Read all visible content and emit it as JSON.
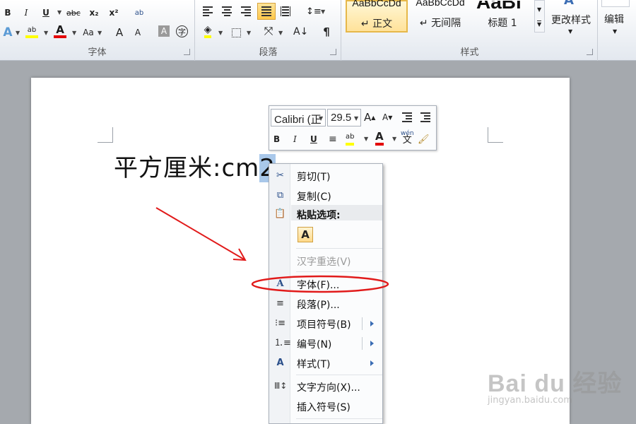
{
  "ribbon": {
    "font_group": {
      "label": "字体",
      "row1": [
        "B",
        "I",
        "U",
        "abc",
        "x₂",
        "x²",
        "ab"
      ],
      "row2": [
        "A",
        "ab",
        "A",
        "Aa",
        "A",
        "A",
        "A",
        "字"
      ]
    },
    "paragraph_group": {
      "label": "段落"
    },
    "styles_group": {
      "label": "样式",
      "styles": [
        {
          "sample": "AaBbCcDd",
          "name": "↵ 正文"
        },
        {
          "sample": "AaBbCcDd",
          "name": "↵ 无间隔"
        },
        {
          "sample": "AaBl",
          "name": "标题 1"
        }
      ],
      "change_styles": "更改样式"
    },
    "editing_group": {
      "label": "编辑"
    }
  },
  "document": {
    "text_before_selection": "平方厘米:cm",
    "selected_text": "2"
  },
  "mini_toolbar": {
    "font_name": "Calibri (正",
    "font_size": "29.5",
    "buttons": [
      "B",
      "I",
      "U",
      "≡",
      "ab",
      "A",
      "wén",
      "🖌"
    ]
  },
  "context_menu": {
    "items": [
      {
        "icon": "scissors-icon",
        "label": "剪切(T)",
        "enabled": true
      },
      {
        "icon": "copy-icon",
        "label": "复制(C)",
        "enabled": true
      },
      {
        "icon": "clipboard-icon",
        "label": "粘贴选项:",
        "enabled": true,
        "header": true
      },
      {
        "icon": "paste-keep-text-icon",
        "label": "A",
        "enabled": true
      },
      {
        "icon": "",
        "label": "汉字重选(V)",
        "enabled": false
      },
      {
        "icon": "font-icon",
        "label": "字体(F)...",
        "enabled": true,
        "highlighted": true
      },
      {
        "icon": "paragraph-icon",
        "label": "段落(P)...",
        "enabled": true
      },
      {
        "icon": "bullets-icon",
        "label": "项目符号(B)",
        "enabled": true,
        "submenu": true,
        "split": true
      },
      {
        "icon": "numbering-icon",
        "label": "编号(N)",
        "enabled": true,
        "submenu": true,
        "split": true
      },
      {
        "icon": "styles-icon",
        "label": "样式(T)",
        "enabled": true,
        "submenu": true
      },
      {
        "icon": "text-direction-icon",
        "label": "文字方向(X)...",
        "enabled": true
      },
      {
        "icon": "",
        "label": "插入符号(S)",
        "enabled": true
      }
    ]
  },
  "annotation": {
    "color": "#e11a1a",
    "target": "字体(F)..."
  },
  "watermark": {
    "brand": "Bai du 经验",
    "url": "jingyan.baidu.com"
  },
  "colors": {
    "ribbon_bg": "#eef1f5",
    "canvas_bg": "#a5a9ae",
    "selection": "#a9c8ea",
    "highlight_yellow": "#ffff00",
    "font_red": "#e30000",
    "active_button": "#ffc84a"
  }
}
